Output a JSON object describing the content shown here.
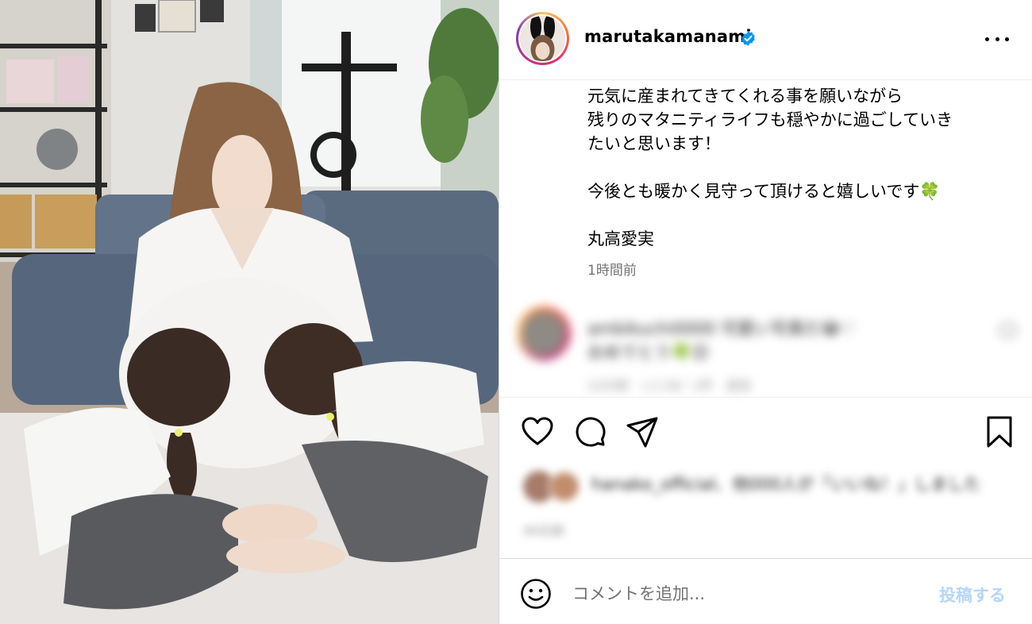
{
  "post": {
    "username": "marutakamanami",
    "verified": true,
    "caption_lines": [
      "元気に産まれてきてくれる事を願いながら",
      "残りのマタニティライフも穏やかに過ごしていき",
      "たいと思います！",
      "",
      "今後とも暖かく見守って頂けると嬉しいです",
      "",
      "丸高愛実"
    ],
    "caption_emoji": "🍀",
    "timestamp": "1時間前"
  },
  "blurred_comment": {
    "line1": "ambikuchi0000 可愛い写真だ😂♡",
    "line2": "おめでとう🍀😊",
    "meta": "12分前　いいね！1件　返信"
  },
  "liked_by": {
    "text": "hanako_official、他000人が「いいね！」しました",
    "date": "00日前"
  },
  "comment_box": {
    "placeholder": "コメントを追加...",
    "post_label": "投稿する"
  },
  "colors": {
    "verified_blue": "#0095f6",
    "post_button_disabled": "#b6d6f6",
    "muted_text": "#737373"
  },
  "icons": [
    "heart-icon",
    "comment-icon",
    "share-icon",
    "bookmark-icon",
    "emoji-icon",
    "more-icon",
    "verified-icon"
  ]
}
